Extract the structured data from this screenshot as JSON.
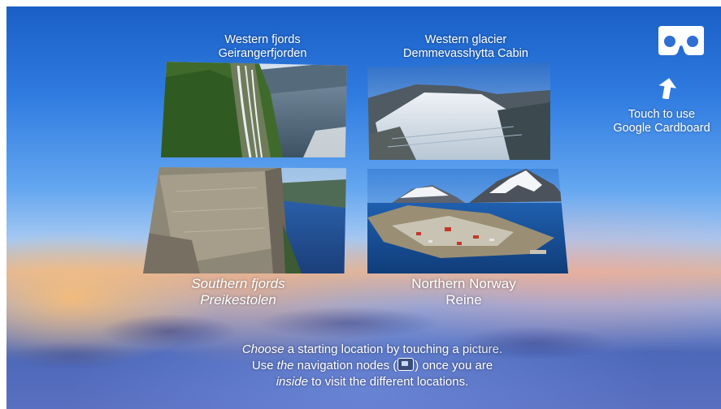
{
  "locations": [
    {
      "region": "Western fjords",
      "place": "Geirangerfjorden"
    },
    {
      "region": "Western glacier",
      "place": "Demmevasshytta Cabin"
    },
    {
      "region": "Southern fjords",
      "place": "Preikestolen"
    },
    {
      "region": "Northern Norway",
      "place": "Reine"
    }
  ],
  "cardboard": {
    "icon": "cardboard-viewer-icon",
    "line1": "Touch to use",
    "line2": "Google Cardboard"
  },
  "instructions": {
    "line1_em": "Choose",
    "line1_rest": " a starting location by touching a picture.",
    "line2_a": "Use ",
    "line2_em": "the",
    "line2_b": " navigation nodes (",
    "nav_icon": "navigation-node-icon",
    "line2_c": ") once you are",
    "line3_em": "inside",
    "line3_rest": " to visit the different locations."
  }
}
